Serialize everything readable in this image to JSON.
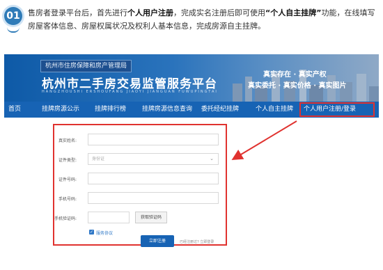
{
  "step": {
    "number": "01",
    "text_parts": [
      "售房者登录平台后，首先进行",
      "个人用户注册",
      "，完成实名注册后即可使用",
      "“个人自主挂牌”",
      "功能，在线填写房屋客体信息、房屋权属状况及权利人基本信息，完成房源自主挂牌。"
    ]
  },
  "header": {
    "department": "杭州市住房保障和房产管理局",
    "title": "杭州市二手房交易监管服务平台",
    "subtitle": "HANGZHOUSHI  ERSHOUFANG  JIAOYI  JIANGUAN  FUWUPINGTAI",
    "slogan_line1": "真实存在 · 真实产权",
    "slogan_line2": "真实委托 · 真实价格 · 真实图片"
  },
  "nav": {
    "items": [
      "首页",
      "挂牌房源公示",
      "挂牌排行榜",
      "挂牌房源信息查询",
      "委托经纪挂牌",
      "个人自主挂牌",
      "个人用户注册/登录"
    ]
  },
  "form": {
    "real_name_label": "真实姓名:",
    "id_type_label": "证件类型:",
    "id_type_value": "身份证",
    "id_number_label": "证件号码:",
    "phone_label": "手机号码:",
    "sms_code_label": "手机验证码:",
    "get_code_button": "获取验证码",
    "agreement": "服务协议",
    "submit_button": "立即注册",
    "login_hint": "已经注册过? 立即登录"
  },
  "colors": {
    "accent": "#1763b4",
    "highlight": "#e0322f"
  }
}
